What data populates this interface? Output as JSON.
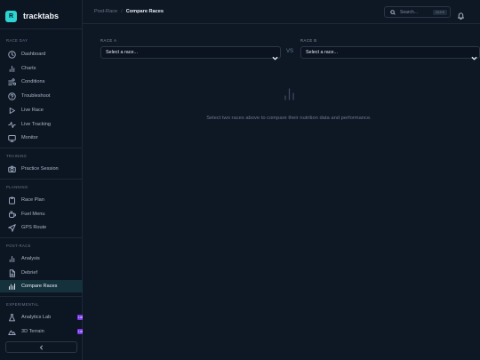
{
  "app": {
    "logo_letter": "R",
    "name": "tracktabs"
  },
  "sidebar": {
    "sections": [
      {
        "title": "Race Day",
        "items": [
          {
            "label": "Dashboard",
            "icon": "clock-icon"
          },
          {
            "label": "Charts",
            "icon": "bar-chart-icon"
          },
          {
            "label": "Conditions",
            "icon": "wind-icon"
          },
          {
            "label": "Troubleshoot",
            "icon": "help-circle-icon"
          },
          {
            "label": "Live Race",
            "icon": "play-icon"
          },
          {
            "label": "Live Tracking",
            "icon": "activity-icon"
          },
          {
            "label": "Monitor",
            "icon": "monitor-icon"
          }
        ]
      },
      {
        "title": "Training",
        "items": [
          {
            "label": "Practice Session",
            "icon": "camera-icon"
          }
        ]
      },
      {
        "title": "Planning",
        "items": [
          {
            "label": "Race Plan",
            "icon": "clipboard-icon"
          },
          {
            "label": "Fuel Menu",
            "icon": "cup-icon"
          },
          {
            "label": "GPS Route",
            "icon": "navigation-icon"
          }
        ]
      },
      {
        "title": "Post-Race",
        "items": [
          {
            "label": "Analysis",
            "icon": "bar-chart-icon"
          },
          {
            "label": "Debrief",
            "icon": "file-text-icon"
          },
          {
            "label": "Compare Races",
            "icon": "compare-bars-icon",
            "active": true
          }
        ]
      },
      {
        "title": "Experimental",
        "items": [
          {
            "label": "Analytics Lab",
            "icon": "flask-icon",
            "badge": "Labs"
          },
          {
            "label": "3D Terrain",
            "icon": "mountain-icon",
            "badge": "Labs"
          }
        ]
      }
    ],
    "collapse_icon": "chevron-left-icon"
  },
  "topbar": {
    "breadcrumb_parent": "Post-Race",
    "breadcrumb_separator": "/",
    "breadcrumb_current": "Compare Races",
    "search_placeholder": "Search...",
    "search_shortcut": "Ctrl+K",
    "bell_icon": "bell-icon"
  },
  "compare": {
    "race_a_label": "Race A",
    "race_a_value": "Select a race...",
    "vs_label": "VS",
    "race_b_label": "Race B",
    "race_b_value": "Select a race...",
    "empty_message": "Select two races above to compare their nutrition data and performance."
  },
  "colors": {
    "accent": "#2dd4d4",
    "active_bg": "#15323c",
    "badge": "#7c3aed",
    "background": "#0e1724"
  }
}
